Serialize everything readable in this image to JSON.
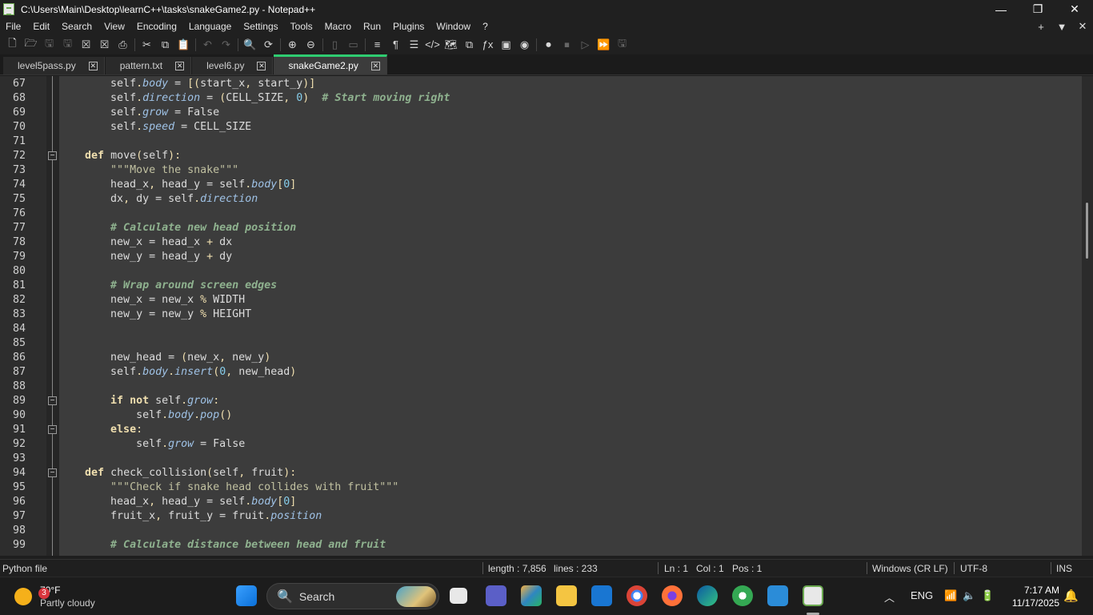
{
  "window": {
    "title": "C:\\Users\\Main\\Desktop\\learnC++\\tasks\\snakeGame2.py - Notepad++",
    "minimize": "—",
    "maximize": "❐",
    "close": "✕"
  },
  "menu": {
    "items": [
      "File",
      "Edit",
      "Search",
      "View",
      "Encoding",
      "Language",
      "Settings",
      "Tools",
      "Macro",
      "Run",
      "Plugins",
      "Window",
      "?"
    ],
    "right": [
      "+",
      "▼",
      "✕"
    ]
  },
  "tabs": [
    {
      "label": "level5pass.py",
      "active": false
    },
    {
      "label": "pattern.txt",
      "active": false
    },
    {
      "label": "level6.py",
      "active": false
    },
    {
      "label": "snakeGame2.py",
      "active": true
    }
  ],
  "editor": {
    "first_line": 67,
    "lines": [
      [
        [
          "t",
          "        "
        ],
        [
          "s",
          "self"
        ],
        [
          "o",
          "."
        ],
        [
          "a",
          "body"
        ],
        [
          "t",
          " = "
        ],
        [
          "o",
          "[("
        ],
        [
          "t",
          "start_x"
        ],
        [
          "o",
          ", "
        ],
        [
          "t",
          "start_y"
        ],
        [
          "o",
          ")]"
        ]
      ],
      [
        [
          "t",
          "        "
        ],
        [
          "s",
          "self"
        ],
        [
          "o",
          "."
        ],
        [
          "a",
          "direction"
        ],
        [
          "t",
          " = "
        ],
        [
          "o",
          "("
        ],
        [
          "t",
          "CELL_SIZE"
        ],
        [
          "o",
          ", "
        ],
        [
          "n",
          "0"
        ],
        [
          "o",
          ")"
        ],
        [
          "t",
          "  "
        ],
        [
          "c",
          "# Start moving right"
        ]
      ],
      [
        [
          "t",
          "        "
        ],
        [
          "s",
          "self"
        ],
        [
          "o",
          "."
        ],
        [
          "a",
          "grow"
        ],
        [
          "t",
          " = False"
        ]
      ],
      [
        [
          "t",
          "        "
        ],
        [
          "s",
          "self"
        ],
        [
          "o",
          "."
        ],
        [
          "a",
          "speed"
        ],
        [
          "t",
          " = CELL_SIZE"
        ]
      ],
      [],
      [
        [
          "t",
          "    "
        ],
        [
          "k",
          "def"
        ],
        [
          "t",
          " move"
        ],
        [
          "o",
          "("
        ],
        [
          "t",
          "self"
        ],
        [
          "o",
          "):"
        ]
      ],
      [
        [
          "t",
          "        "
        ],
        [
          "q",
          "\"\"\"Move the snake\"\"\""
        ]
      ],
      [
        [
          "t",
          "        head_x"
        ],
        [
          "o",
          ", "
        ],
        [
          "t",
          "head_y = "
        ],
        [
          "s",
          "self"
        ],
        [
          "o",
          "."
        ],
        [
          "a",
          "body"
        ],
        [
          "o",
          "["
        ],
        [
          "n",
          "0"
        ],
        [
          "o",
          "]"
        ]
      ],
      [
        [
          "t",
          "        dx"
        ],
        [
          "o",
          ", "
        ],
        [
          "t",
          "dy = "
        ],
        [
          "s",
          "self"
        ],
        [
          "o",
          "."
        ],
        [
          "a",
          "direction"
        ]
      ],
      [],
      [
        [
          "t",
          "        "
        ],
        [
          "c",
          "# Calculate new head position"
        ]
      ],
      [
        [
          "t",
          "        new_x = head_x "
        ],
        [
          "o",
          "+"
        ],
        [
          "t",
          " dx"
        ]
      ],
      [
        [
          "t",
          "        new_y = head_y "
        ],
        [
          "o",
          "+"
        ],
        [
          "t",
          " dy"
        ]
      ],
      [],
      [
        [
          "t",
          "        "
        ],
        [
          "c",
          "# Wrap around screen edges"
        ]
      ],
      [
        [
          "t",
          "        new_x = new_x "
        ],
        [
          "o",
          "%"
        ],
        [
          "t",
          " WIDTH"
        ]
      ],
      [
        [
          "t",
          "        new_y = new_y "
        ],
        [
          "o",
          "%"
        ],
        [
          "t",
          " HEIGHT"
        ]
      ],
      [],
      [],
      [
        [
          "t",
          "        new_head = "
        ],
        [
          "o",
          "("
        ],
        [
          "t",
          "new_x"
        ],
        [
          "o",
          ", "
        ],
        [
          "t",
          "new_y"
        ],
        [
          "o",
          ")"
        ]
      ],
      [
        [
          "t",
          "        "
        ],
        [
          "s",
          "self"
        ],
        [
          "o",
          "."
        ],
        [
          "a",
          "body"
        ],
        [
          "o",
          "."
        ],
        [
          "a",
          "insert"
        ],
        [
          "o",
          "("
        ],
        [
          "n",
          "0"
        ],
        [
          "o",
          ", "
        ],
        [
          "t",
          "new_head"
        ],
        [
          "o",
          ")"
        ]
      ],
      [],
      [
        [
          "t",
          "        "
        ],
        [
          "k",
          "if not"
        ],
        [
          "t",
          " "
        ],
        [
          "s",
          "self"
        ],
        [
          "o",
          "."
        ],
        [
          "a",
          "grow"
        ],
        [
          "o",
          ":"
        ]
      ],
      [
        [
          "t",
          "            "
        ],
        [
          "s",
          "self"
        ],
        [
          "o",
          "."
        ],
        [
          "a",
          "body"
        ],
        [
          "o",
          "."
        ],
        [
          "a",
          "pop"
        ],
        [
          "o",
          "()"
        ]
      ],
      [
        [
          "t",
          "        "
        ],
        [
          "k",
          "else"
        ],
        [
          "o",
          ":"
        ]
      ],
      [
        [
          "t",
          "            "
        ],
        [
          "s",
          "self"
        ],
        [
          "o",
          "."
        ],
        [
          "a",
          "grow"
        ],
        [
          "t",
          " = False"
        ]
      ],
      [],
      [
        [
          "t",
          "    "
        ],
        [
          "k",
          "def"
        ],
        [
          "t",
          " check_collision"
        ],
        [
          "o",
          "("
        ],
        [
          "t",
          "self"
        ],
        [
          "o",
          ", "
        ],
        [
          "t",
          "fruit"
        ],
        [
          "o",
          "):"
        ]
      ],
      [
        [
          "t",
          "        "
        ],
        [
          "q",
          "\"\"\"Check if snake head collides with fruit\"\"\""
        ]
      ],
      [
        [
          "t",
          "        head_x"
        ],
        [
          "o",
          ", "
        ],
        [
          "t",
          "head_y = "
        ],
        [
          "s",
          "self"
        ],
        [
          "o",
          "."
        ],
        [
          "a",
          "body"
        ],
        [
          "o",
          "["
        ],
        [
          "n",
          "0"
        ],
        [
          "o",
          "]"
        ]
      ],
      [
        [
          "t",
          "        fruit_x"
        ],
        [
          "o",
          ", "
        ],
        [
          "t",
          "fruit_y = fruit"
        ],
        [
          "o",
          "."
        ],
        [
          "a",
          "position"
        ]
      ],
      [],
      [
        [
          "t",
          "        "
        ],
        [
          "c",
          "# Calculate distance between head and fruit"
        ]
      ]
    ],
    "folds": [
      {
        "line": 72,
        "symbol": "−"
      },
      {
        "line": 89,
        "symbol": "−"
      },
      {
        "line": 91,
        "symbol": "−"
      },
      {
        "line": 94,
        "symbol": "−"
      }
    ]
  },
  "status": {
    "filetype": "Python file",
    "length": "length : 7,856",
    "lines": "lines : 233",
    "ln": "Ln : 1",
    "col": "Col : 1",
    "pos": "Pos : 1",
    "eol": "Windows (CR LF)",
    "encoding": "UTF-8",
    "mode": "INS"
  },
  "taskbar": {
    "weather_temp": "70°F",
    "weather_desc": "Partly cloudy",
    "weather_badge": "3",
    "search_placeholder": "Search",
    "lang": "ENG",
    "time": "7:17 AM",
    "date": "11/17/2025"
  },
  "colors": {
    "editor_bg": "#3c3c3c",
    "active_tab_accent": "#2ecc71",
    "keyword": "#f0dfaf",
    "comment": "#8fb28f",
    "attribute": "#9fc2e6"
  }
}
